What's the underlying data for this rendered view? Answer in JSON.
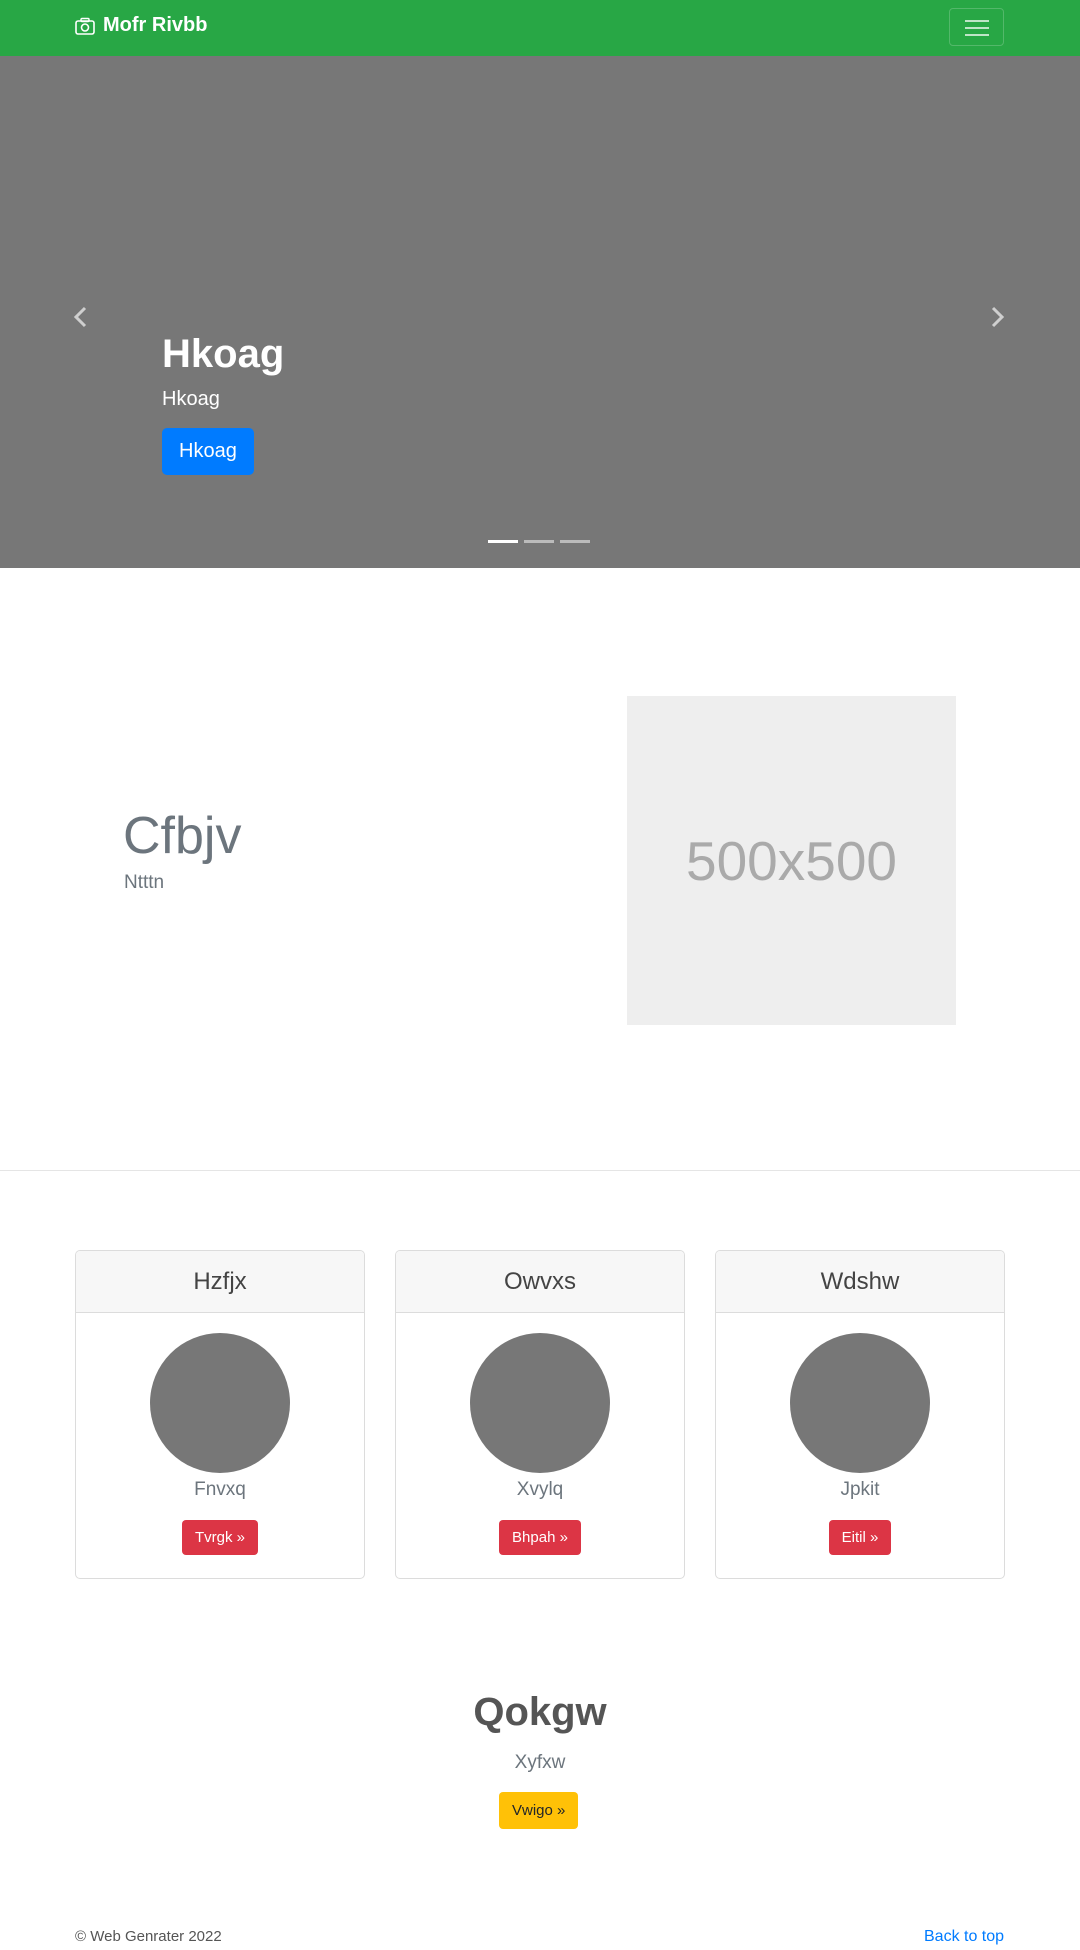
{
  "navbar": {
    "brand": "Mofr Rivbb",
    "brand_icon": "camera-icon",
    "toggler_icon": "hamburger-icon",
    "color": "#28a745"
  },
  "carousel": {
    "title": "Hkoag",
    "subtitle": "Hkoag",
    "button": "Hkoag",
    "prev_icon": "chevron-left-icon",
    "next_icon": "chevron-right-icon",
    "slides": 3,
    "active_slide": 1
  },
  "feature": {
    "title": "Cfbjv",
    "subtitle": "Ntttn",
    "image_label": "500x500"
  },
  "cards": [
    {
      "title": "Hzfjx",
      "text": "Fnvxq",
      "button": "Tvrgk »"
    },
    {
      "title": "Owvxs",
      "text": "Xvylq",
      "button": "Bhpah »"
    },
    {
      "title": "Wdshw",
      "text": "Jpkit",
      "button": "Eitil »"
    }
  ],
  "cta": {
    "title": "Qokgw",
    "subtitle": "Xyfxw",
    "button": "Vwigo »"
  },
  "footer": {
    "copyright": "© Web Genrater 2022",
    "back_to_top": "Back to top"
  }
}
